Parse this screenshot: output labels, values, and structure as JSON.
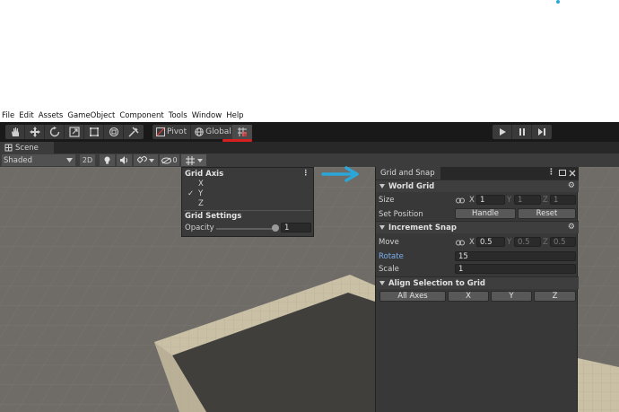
{
  "menu": [
    "File",
    "Edit",
    "Assets",
    "GameObject",
    "Component",
    "Tools",
    "Window",
    "Help"
  ],
  "toolbar": {
    "tools": [
      "hand-icon",
      "move-icon",
      "rotate-icon",
      "scale-icon",
      "rect-icon",
      "transform-icon",
      "custom-tool-icon"
    ],
    "pivot_label": "Pivot",
    "global_label": "Global",
    "grid_snap_icon": "grid-snap-icon",
    "play_icons": [
      "play-icon",
      "pause-icon",
      "step-icon"
    ]
  },
  "scene_tab": {
    "label": "Scene"
  },
  "scene_toolbar": {
    "shading_mode": "Shaded",
    "mode_2d": "2D",
    "hidden_count": "0"
  },
  "grid_popup": {
    "axis_title": "Grid Axis",
    "axes": [
      "X",
      "Y",
      "Z"
    ],
    "selected_axis": "Y",
    "check": "✓",
    "settings_title": "Grid Settings",
    "opacity_label": "Opacity",
    "opacity_value": "1",
    "opacity_level": 1.0
  },
  "grid_snap": {
    "tab_label": "Grid and Snap",
    "world_grid": {
      "title": "World Grid",
      "size_label": "Size",
      "size": {
        "x_label": "X",
        "x": "1",
        "y_label": "Y",
        "y": "1",
        "z_label": "Z",
        "z": "1"
      },
      "set_position_label": "Set Position",
      "handle_button": "Handle",
      "reset_button": "Reset"
    },
    "increment_snap": {
      "title": "Increment Snap",
      "move_label": "Move",
      "move": {
        "x_label": "X",
        "x": "0.5",
        "y_label": "Y",
        "y": "0.5",
        "z_label": "Z",
        "z": "0.5"
      },
      "rotate_label": "Rotate",
      "rotate_value": "15",
      "scale_label": "Scale",
      "scale_value": "1"
    },
    "align": {
      "title": "Align Selection to Grid",
      "all_axes": "All Axes",
      "x": "X",
      "y": "Y",
      "z": "Z"
    }
  },
  "colors": {
    "annotation_arrow": "#2aa7d8",
    "annotation_underline": "#d61f1f",
    "rotate_label": "#7cb0f0"
  }
}
